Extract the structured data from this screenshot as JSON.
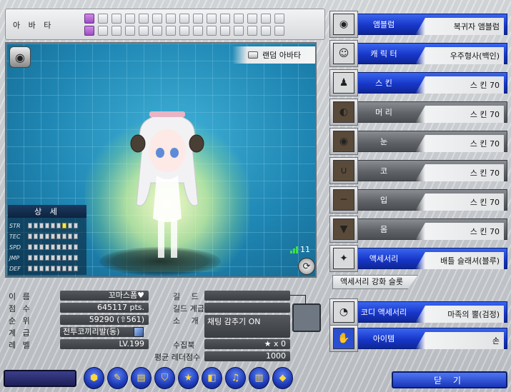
{
  "avatar_bar": {
    "label": "아 바 타",
    "slots": [
      1,
      0,
      0,
      0,
      0,
      0,
      0,
      0,
      0,
      0,
      0,
      0,
      0,
      0,
      0,
      1,
      0,
      0,
      0,
      0,
      0,
      0,
      0,
      0,
      0,
      0,
      0,
      0,
      0,
      0
    ]
  },
  "viewport": {
    "random_avatar_label": "랜덤 아바타",
    "stats_title": "상 세",
    "stats": [
      {
        "label": "STR",
        "filled": [
          0,
          0,
          0,
          0,
          0,
          0,
          1,
          0,
          0
        ]
      },
      {
        "label": "TEC",
        "filled": [
          0,
          0,
          0,
          0,
          0,
          0,
          0,
          0,
          0
        ]
      },
      {
        "label": "SPD",
        "filled": [
          0,
          0,
          0,
          0,
          0,
          0,
          0,
          0,
          0
        ]
      },
      {
        "label": "JMP",
        "filled": [
          0,
          0,
          0,
          0,
          0,
          0,
          0,
          0,
          0
        ]
      },
      {
        "label": "DEF",
        "filled": [
          0,
          0,
          0,
          0,
          0,
          0,
          0,
          0,
          0
        ]
      }
    ],
    "signal_value": "11"
  },
  "info": {
    "name_label": "이 름",
    "name_value": "꼬마스폼♥",
    "score_label": "점 수",
    "score_value": "645117 pts.",
    "rank_label": "순 위",
    "rank_value": "59290 (⇧561)",
    "grade_label": "계 급",
    "grade_value": "전투코끼리발(동)",
    "level_label": "레 벨",
    "level_value": "LV.199",
    "guild_label": "길 드",
    "guild_value": "",
    "guild_grade_label": "길드 계급",
    "guild_grade_value": "",
    "intro_label": "소 개",
    "intro_value": "채팅 감추기 ON",
    "collection_label": "수집북",
    "collection_value": "★ x 0",
    "ladder_label": "평균 레더점수",
    "ladder_value": "1000"
  },
  "categories": [
    {
      "key": "emblem",
      "label": "앰블럼",
      "value": "복귀자 앰블럼",
      "icon": "emblem-icon",
      "gray": false
    },
    {
      "key": "character",
      "label": "캐 릭 터",
      "value": "우주형사(백인)",
      "icon": "character-portrait-icon",
      "gray": false
    },
    {
      "key": "skin",
      "label": "스 킨",
      "value": "스 킨 70",
      "icon": "skin-silhouette-icon",
      "gray": false
    },
    {
      "key": "hair",
      "label": "머 리",
      "value": "스 킨 70",
      "icon": "hair-icon",
      "gray": true
    },
    {
      "key": "eyes",
      "label": "눈",
      "value": "스 킨 70",
      "icon": "eyes-icon",
      "gray": true
    },
    {
      "key": "nose",
      "label": "코",
      "value": "스 킨 70",
      "icon": "nose-icon",
      "gray": true
    },
    {
      "key": "mouth",
      "label": "입",
      "value": "스 킨 70",
      "icon": "mouth-icon",
      "gray": true
    },
    {
      "key": "body",
      "label": "몸",
      "value": "스 킨 70",
      "icon": "body-icon",
      "gray": true
    },
    {
      "key": "accessory",
      "label": "액세서리",
      "value": "배틀 슬래셔(블루)",
      "icon": "accessory-icon",
      "gray": false
    },
    {
      "key": "codi",
      "label": "코디 액세서리",
      "value": "마족의 뿔(검정)",
      "icon": "horn-icon",
      "gray": false
    },
    {
      "key": "item",
      "label": "아이템",
      "value": "손",
      "icon": "hand-icon",
      "gray": false
    }
  ],
  "accessory_slot_label": "액세서리 강화 슬롯",
  "toolbar": {
    "buttons": [
      "hexagon-icon",
      "speech-bubble-icon",
      "folder-icon",
      "shield-icon",
      "star-icon",
      "bag-icon",
      "bell-icon",
      "chart-icon",
      "card-icon"
    ]
  },
  "close_label": "닫 기"
}
